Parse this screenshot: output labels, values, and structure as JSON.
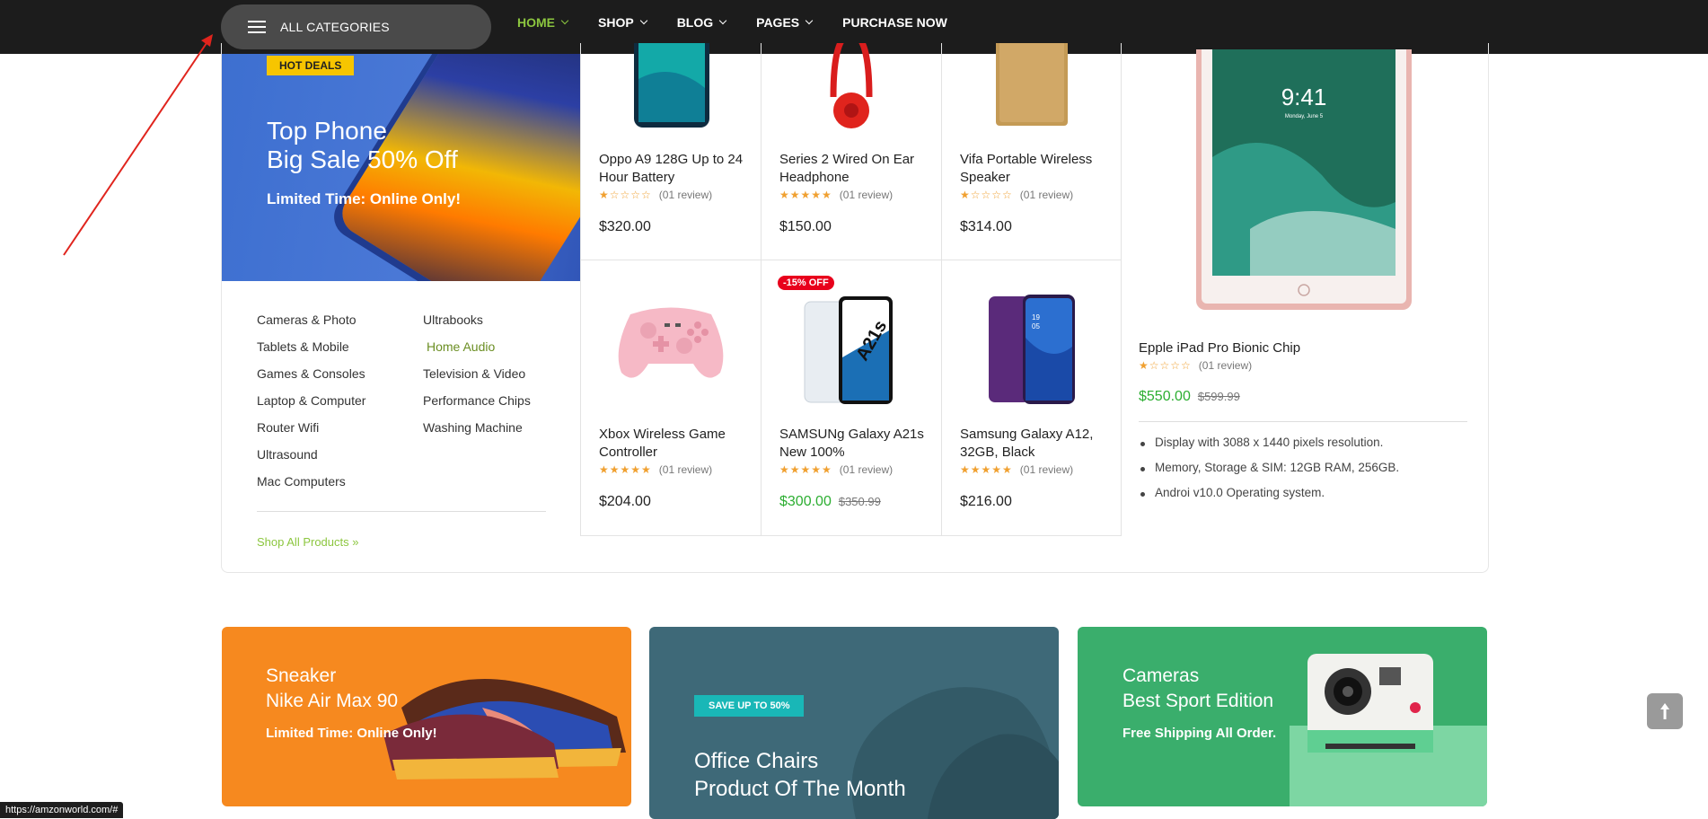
{
  "header": {
    "all_categories": "ALL CATEGORIES",
    "nav": [
      {
        "label": "HOME",
        "active": true,
        "dropdown": true
      },
      {
        "label": "SHOP",
        "dropdown": true
      },
      {
        "label": "BLOG",
        "dropdown": true
      },
      {
        "label": "PAGES",
        "dropdown": true
      },
      {
        "label": "PURCHASE NOW",
        "dropdown": false
      }
    ],
    "active_color": "#8cc63f"
  },
  "hero": {
    "badge": "HOT DEALS",
    "title_line1": "Top Phone",
    "title_line2": "Big Sale 50% Off",
    "subtitle": "Limited Time: Online Only!"
  },
  "categories": {
    "col1": [
      "Cameras & Photo",
      "Tablets & Mobile",
      "Games & Consoles",
      "Laptop & Computer",
      "Router Wifi",
      "Ultrasound",
      "Mac Computers"
    ],
    "col2": [
      "Ultrabooks",
      "Home Audio",
      "Television & Video",
      "Performance Chips",
      "Washing Machine"
    ],
    "shop_all": "Shop All Products"
  },
  "products": [
    {
      "name": "Oppo A9 128G Up to 24 Hour Battery",
      "rating": 1,
      "reviews": "(01 review)",
      "price": "$320.00",
      "image": "phone-teal"
    },
    {
      "name": "Series 2 Wired On Ear Headphone",
      "rating": 5,
      "reviews": "(01 review)",
      "price": "$150.00",
      "image": "headphone-red"
    },
    {
      "name": "Vifa Portable Wireless Speaker",
      "rating": 1,
      "reviews": "(01 review)",
      "price": "$314.00",
      "image": "speaker-wood"
    },
    {
      "name": "Xbox Wireless Game Controller",
      "rating": 5,
      "reviews": "(01 review)",
      "price": "$204.00",
      "image": "controller-pink"
    },
    {
      "name": "SAMSUNg Galaxy A21s New 100%",
      "rating": 5,
      "reviews": "(01 review)",
      "price": "$300.00",
      "old_price": "$350.99",
      "sale": "-15% OFF",
      "image": "phone-white"
    },
    {
      "name": "Samsung Galaxy A12, 32GB, Black",
      "rating": 5,
      "reviews": "(01 review)",
      "price": "$216.00",
      "image": "phone-purple"
    }
  ],
  "featured": {
    "name": "Epple iPad Pro Bionic Chip",
    "reviews": "(01 review)",
    "price": "$550.00",
    "old_price": "$599.99",
    "features": [
      "Display with 3088 x 1440 pixels resolution.",
      "Memory, Storage & SIM: 12GB RAM, 256GB.",
      "Androi v10.0 Operating system."
    ],
    "ipad_time": "9:41",
    "ipad_date": "Monday, June 5"
  },
  "banners": [
    {
      "line1": "Sneaker",
      "line2": "Nike Air Max 90",
      "sub": "Limited Time: Online Only!",
      "color": "#f6891f"
    },
    {
      "badge": "SAVE UP TO 50%",
      "line1": "Office Chairs",
      "line2": "Product Of The Month",
      "color": "#3e6978"
    },
    {
      "line1": "Cameras",
      "line2": "Best Sport Edition",
      "sub": "Free Shipping All Order.",
      "color": "#3aae6c"
    }
  ],
  "status_url": "https://amzonworld.com/#"
}
